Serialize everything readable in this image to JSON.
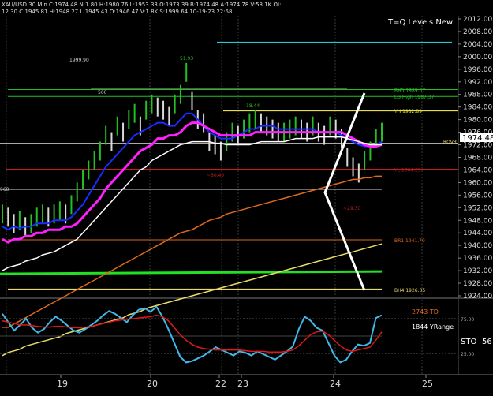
{
  "header": {
    "line1": "XAU/USD  30 Min  C:1974.48  N:1.80  H:1980.76  L:1953.33  O:1973.39  B:1974.48  A:1974.78  V:58.1K  OI:",
    "line2": "12.30  C:1945.81  H:1948.27  L:1945.43  O:1946.47  V:1.8K  S:1999.64  10-19-23  22:58"
  },
  "title": "T=Q Levels New",
  "colors": {
    "background": "#000000",
    "price_up": "#22c022",
    "price_down": "#d9d9d9",
    "ma_blue": "#1a2cff",
    "ma_magenta": "#ff1fff",
    "ma_white": "#ffffff",
    "ma_orange": "#e06a1a",
    "ma_yellow": "#e8dc6a",
    "level_cyan": "#20c8d8",
    "level_green": "#22e022",
    "level_red": "#c81e1e",
    "sto_line": "#40b8e8",
    "sto_signal": "#e01818"
  },
  "chart_data": [
    {
      "type": "line",
      "name": "price_panel",
      "ylim": [
        1924,
        2012
      ],
      "y_ticks": [
        "2012.00",
        "2008.00",
        "2004.00",
        "2000.00",
        "1996.00",
        "1992.00",
        "1988.00",
        "1984.00",
        "1980.00",
        "1976.00",
        "1972.00",
        "1968.00",
        "1964.00",
        "1960.00",
        "1956.00",
        "1952.00",
        "1948.00",
        "1944.00",
        "1940.00",
        "1936.00",
        "1932.00",
        "1928.00",
        "1924.00"
      ],
      "x_ticks": [
        "19",
        "20",
        "22",
        "23",
        "24",
        "25"
      ],
      "last_price": "1974.48",
      "series": [
        {
          "color": "#22c022",
          "values": [
            1950,
            1949,
            1947,
            1948,
            1946,
            1947,
            1949,
            1950,
            1949,
            1950,
            1951,
            1950,
            1953,
            1957,
            1961,
            1964,
            1967,
            1970,
            1975,
            1973,
            1978,
            1976,
            1980,
            1982,
            1978,
            1983,
            1985,
            1984,
            1983,
            1981,
            1985,
            1988,
            1995,
            1986,
            1980,
            1979,
            1973,
            1972,
            1970,
            1973,
            1976,
            1975,
            1977,
            1979,
            1980,
            1979,
            1978,
            1977,
            1976,
            1976,
            1977,
            1978,
            1977,
            1976,
            1978,
            1976,
            1975,
            1978,
            1977,
            1974,
            1968,
            1965,
            1963,
            1967,
            1970,
            1974,
            1976
          ]
        },
        {
          "color": "#1a2cff",
          "values": [
            1946,
            1945,
            1946,
            1945.5,
            1946,
            1946,
            1947,
            1947,
            1947,
            1948,
            1948,
            1948,
            1949,
            1951,
            1953,
            1956,
            1959,
            1962,
            1965,
            1967,
            1969,
            1971,
            1973,
            1975,
            1976,
            1977,
            1978,
            1979,
            1979,
            1978,
            1978,
            1980,
            1982,
            1982,
            1980,
            1978,
            1976,
            1975,
            1974,
            1974,
            1974,
            1975,
            1976,
            1977,
            1977,
            1978,
            1978,
            1978,
            1977,
            1977,
            1977,
            1977,
            1977,
            1977,
            1977,
            1976,
            1976,
            1976,
            1976,
            1975,
            1974,
            1973,
            1972,
            1971.5,
            1971.5,
            1972,
            1973
          ]
        },
        {
          "color": "#ff1fff",
          "values": [
            1942,
            1941,
            1942,
            1942,
            1943,
            1943,
            1944,
            1944,
            1945,
            1945,
            1945,
            1946,
            1946,
            1947,
            1949,
            1951,
            1953,
            1955,
            1958,
            1960,
            1962,
            1964,
            1966,
            1968,
            1970,
            1971,
            1972,
            1974,
            1974,
            1975,
            1975,
            1976,
            1978,
            1979,
            1979,
            1978,
            1977,
            1976,
            1975,
            1975,
            1975,
            1975,
            1975,
            1975,
            1976,
            1976,
            1976,
            1976,
            1976,
            1976,
            1976,
            1976,
            1976,
            1976,
            1976,
            1976,
            1976,
            1976,
            1976,
            1976,
            1975,
            1974,
            1973,
            1972,
            1971.5,
            1971.5,
            1972
          ]
        },
        {
          "color": "#ffffff",
          "values": [
            1932,
            1933,
            1933.5,
            1934,
            1935,
            1935.5,
            1936,
            1937,
            1937.5,
            1938,
            1939,
            1940,
            1941,
            1942,
            1944,
            1946,
            1948,
            1950,
            1952,
            1954,
            1956,
            1958,
            1960,
            1962,
            1964,
            1965,
            1967,
            1968,
            1969,
            1970,
            1971,
            1972,
            1972.5,
            1973,
            1973,
            1973,
            1973,
            1972.5,
            1972.5,
            1972,
            1972,
            1972,
            1972,
            1972,
            1972.5,
            1973,
            1973,
            1973,
            1973,
            1973,
            1973.5,
            1974,
            1974,
            1974,
            1974,
            1974.5,
            1974.5,
            1974.5,
            1974.5,
            1974.5,
            1974,
            1973.5,
            1973,
            1972.5,
            1972,
            1972,
            1972
          ]
        },
        {
          "color": "#e06a1a",
          "values": [
            1914,
            1914,
            1915,
            1916,
            1917,
            1918,
            1919,
            1920,
            1921,
            1922,
            1923,
            1924,
            1925,
            1926,
            1927,
            1928,
            1929,
            1930,
            1931,
            1932,
            1933,
            1934,
            1935,
            1936,
            1937,
            1938,
            1939,
            1940,
            1941,
            1942,
            1943,
            1944,
            1944.5,
            1945,
            1946,
            1947,
            1948,
            1948.5,
            1949,
            1950,
            1950.5,
            1951,
            1951.5,
            1952,
            1952.5,
            1953,
            1953.5,
            1954,
            1954.5,
            1955,
            1955.5,
            1956,
            1956.5,
            1957,
            1957.5,
            1958,
            1958.5,
            1959,
            1959.5,
            1960,
            1960.5,
            1961,
            1961,
            1961.5,
            1961.5,
            1962,
            1962
          ]
        },
        {
          "color": "#e8dc6a",
          "values": [
            1905,
            1906,
            1906.5,
            1907,
            1908,
            1908.5,
            1909,
            1909.5,
            1910,
            1910.5,
            1911,
            1912,
            1912.5,
            1913,
            1913.5,
            1914,
            1914.5,
            1915,
            1915.5,
            1916,
            1916.5,
            1917,
            1918,
            1918.5,
            1919,
            1920,
            1920.5,
            1921,
            1921.5,
            1922,
            1922.5,
            1923,
            1923.5,
            1924,
            1924.5,
            1925,
            1925.5,
            1926,
            1926.5,
            1927,
            1927.5,
            1928,
            1928.5,
            1929,
            1929.5,
            1930,
            1930.5,
            1931,
            1931.5,
            1932,
            1932.5,
            1933,
            1933.5,
            1934,
            1934.5,
            1935,
            1935.5,
            1936,
            1936.5,
            1937,
            1937.5,
            1938,
            1938.5,
            1939,
            1939.5,
            1940,
            1940.5
          ]
        }
      ],
      "levels": [
        {
          "value": 2004.5,
          "color": "#20c8d8",
          "label": ""
        },
        {
          "value": 1989.57,
          "color": "#22c022",
          "label": "BH5 1989.57"
        },
        {
          "value": 1987.37,
          "color": "#22c022",
          "label": "LG High 1987.37"
        },
        {
          "value": 1982.89,
          "color": "#e8e040",
          "label": "YH 1982.89"
        },
        {
          "value": 1964.25,
          "color": "#c81e1e",
          "label": "YL 1964.25"
        },
        {
          "value": 1941.79,
          "color": "#e06a1a",
          "label": "BR1 1941.79"
        },
        {
          "value": 1926.05,
          "color": "#e8dc6a",
          "label": "BH4 1926.05"
        }
      ],
      "annotations": [
        {
          "text": "1999.90",
          "color": "#cccccc"
        },
        {
          "text": "51.93",
          "color": "#22c022"
        },
        {
          "text": "500",
          "color": "#cccccc"
        },
        {
          "text": "18.44",
          "color": "#22c022"
        },
        {
          "text": "~30.40",
          "color": "#c81e1e"
        },
        {
          "text": "~29.30",
          "color": "#c81e1e"
        },
        {
          "text": "ROVR",
          "color": "#e8dc6a"
        },
        {
          "text": "960",
          "color": "#cccccc"
        }
      ]
    },
    {
      "type": "line",
      "name": "oscillator_panel",
      "ylim": [
        0,
        100
      ],
      "y_ticks": [
        "75.00",
        "25.00"
      ],
      "labels": {
        "td": "2743 TD",
        "yrange": "1844 YRange",
        "sto": "STO",
        "sto_value": "56"
      },
      "series": [
        {
          "color": "#40b8e8",
          "values": [
            82,
            70,
            58,
            66,
            75,
            62,
            55,
            60,
            70,
            78,
            72,
            65,
            58,
            55,
            60,
            66,
            72,
            80,
            86,
            82,
            76,
            70,
            80,
            88,
            90,
            85,
            92,
            78,
            60,
            40,
            20,
            12,
            14,
            18,
            22,
            28,
            34,
            30,
            26,
            22,
            28,
            26,
            22,
            28,
            24,
            20,
            16,
            22,
            28,
            35,
            60,
            78,
            72,
            62,
            58,
            40,
            22,
            12,
            16,
            28,
            38,
            36,
            40,
            76,
            80
          ]
        },
        {
          "color": "#e01818",
          "values": [
            72,
            70,
            68,
            66,
            66,
            65,
            64,
            63,
            63,
            64,
            64,
            63,
            62,
            62,
            63,
            64,
            66,
            68,
            70,
            72,
            73,
            74,
            75,
            76,
            77,
            78,
            80,
            78,
            72,
            62,
            52,
            44,
            38,
            34,
            32,
            31,
            30,
            30,
            30,
            30,
            30,
            29,
            28,
            28,
            28,
            27,
            27,
            27,
            28,
            30,
            36,
            44,
            52,
            56,
            57,
            52,
            44,
            36,
            30,
            28,
            30,
            32,
            34,
            44,
            56
          ]
        }
      ]
    }
  ]
}
